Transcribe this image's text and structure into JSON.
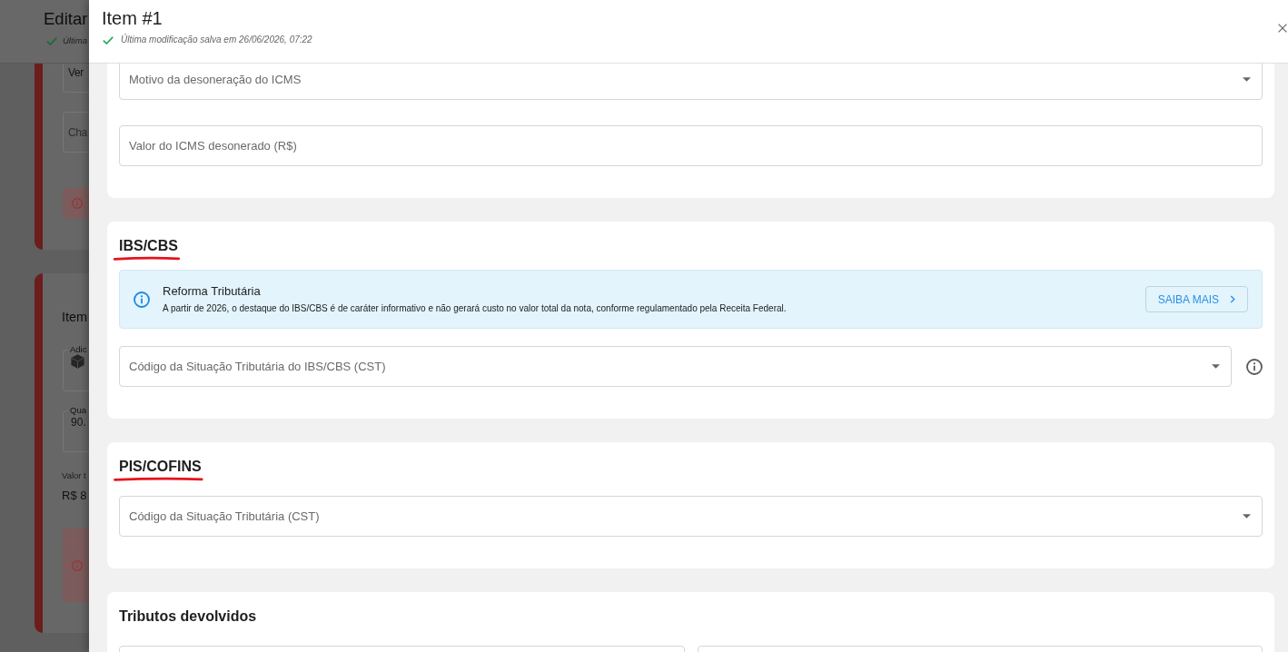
{
  "background_page": {
    "title": "Editar",
    "save_status": "Última",
    "cards": [
      {
        "fields": [
          {
            "kind": "text",
            "value": "Ver"
          },
          {
            "kind": "text",
            "placeholder": "Cha"
          }
        ],
        "alert_shown": true
      },
      {
        "title": "Item",
        "fields": [
          {
            "kind": "product",
            "label": "Adic"
          },
          {
            "kind": "text",
            "label": "Qua",
            "value": "90."
          }
        ],
        "total_label": "Valor t",
        "total_value": "R$ 8",
        "alert_shown": true
      }
    ]
  },
  "drawer": {
    "title": "Item #1",
    "save_status": "Última modificação salva em 26/06/2026, 07:22",
    "sections": [
      {
        "rows": [
          {
            "fields": [
              {
                "kind": "select",
                "placeholder": "Motivo da desoneração do ICMS",
                "help": false
              }
            ]
          },
          {
            "fields": [
              {
                "kind": "input",
                "placeholder": "Valor do ICMS desonerado (R$)",
                "help": false
              }
            ]
          }
        ]
      },
      {
        "title": "IBS/CBS",
        "highlighted": true,
        "notice": {
          "title": "Reforma Tributária",
          "text": "A partir de 2026, o destaque do IBS/CBS é de caráter informativo e não gerará custo no valor total da nota, conforme regulamentado pela Receita Federal.",
          "button": "SAIBA MAIS"
        },
        "rows": [
          {
            "fields": [
              {
                "kind": "select",
                "placeholder": "Código da Situação Tributária do IBS/CBS (CST)",
                "help": true
              }
            ]
          }
        ]
      },
      {
        "title": "PIS/COFINS",
        "highlighted": true,
        "rows": [
          {
            "fields": [
              {
                "kind": "select",
                "placeholder": "Código da Situação Tributária (CST)",
                "help": false
              }
            ]
          }
        ]
      },
      {
        "title": "Tributos devolvidos",
        "highlighted": false,
        "rows": [
          {
            "fields": [
              {
                "kind": "input",
                "help": false
              },
              {
                "kind": "input",
                "help": false
              }
            ]
          }
        ]
      }
    ]
  }
}
